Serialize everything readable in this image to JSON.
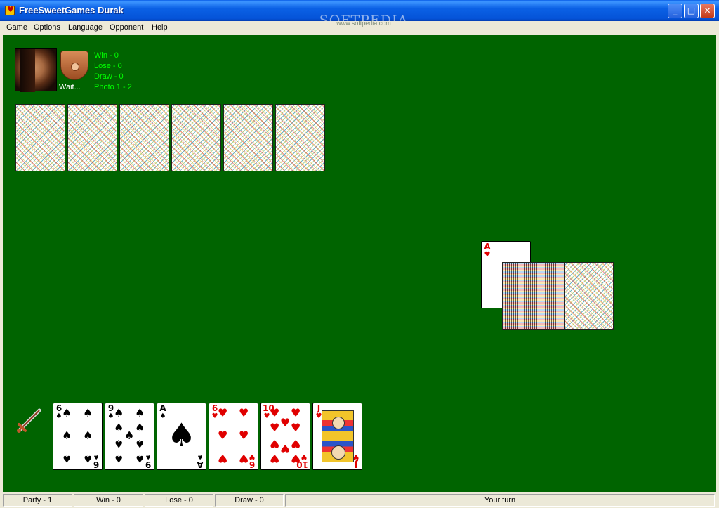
{
  "window": {
    "title": "FreeSweetGames Durak",
    "watermark": "SOFTPEDIA",
    "watermark_sub": "www.softpedia.com",
    "minimize": "_",
    "maximize": "□",
    "close": "✕"
  },
  "menu": [
    "Game",
    "Options",
    "Language",
    "Opponent",
    "Help"
  ],
  "opponent": {
    "status": "Wait...",
    "stats": [
      "Win - 0",
      "Lose - 0",
      "Draw - 0",
      "Photo 1 - 2"
    ],
    "hand_count": 6
  },
  "table": {
    "felt_color": "#006400",
    "trump_card": {
      "rank": "A",
      "suit": "♥",
      "color": "red"
    },
    "deck": "face-down deck"
  },
  "player": {
    "hand": [
      {
        "rank": "6",
        "suit": "♠",
        "color": "black",
        "pips": 6
      },
      {
        "rank": "9",
        "suit": "♠",
        "color": "black",
        "pips": 9
      },
      {
        "rank": "A",
        "suit": "♠",
        "color": "black",
        "pips": 1
      },
      {
        "rank": "6",
        "suit": "♥",
        "color": "red",
        "pips": 6
      },
      {
        "rank": "10",
        "suit": "♥",
        "color": "red",
        "pips": 10
      },
      {
        "rank": "J",
        "suit": "♥",
        "color": "red",
        "pips": 0
      }
    ],
    "action_icon": "sword-icon"
  },
  "statusbar": {
    "party": "Party - 1",
    "win": "Win - 0",
    "lose": "Lose - 0",
    "draw": "Draw - 0",
    "message": "Your turn"
  }
}
